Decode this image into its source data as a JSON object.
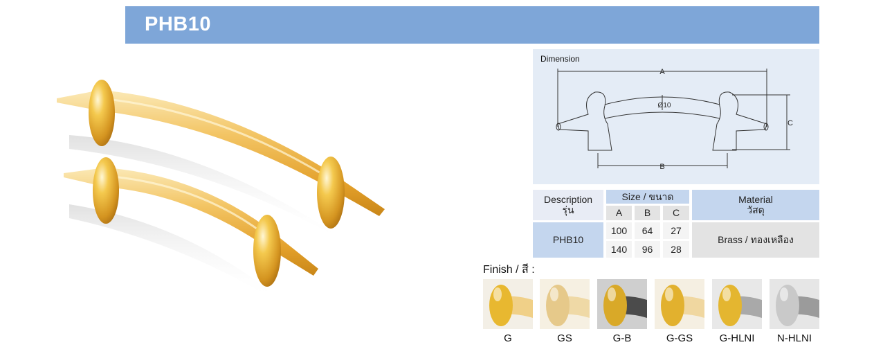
{
  "header": {
    "title": "PHB10"
  },
  "dimension": {
    "title": "Dimension",
    "label_a": "A",
    "label_b": "B",
    "label_c": "C",
    "label_dia": "Ø10"
  },
  "table": {
    "description_header": "Description",
    "description_header_th": "รุ่น",
    "size_header": "Size / ขนาด",
    "col_a": "A",
    "col_b": "B",
    "col_c": "C",
    "material_header": "Material",
    "material_header_th": "วัสดุ",
    "model": "PHB10",
    "rows": [
      {
        "a": "100",
        "b": "64",
        "c": "27"
      },
      {
        "a": "140",
        "b": "96",
        "c": "28"
      }
    ],
    "material": "Brass / ทองเหลือง"
  },
  "finish": {
    "label": "Finish / สี :",
    "options": [
      {
        "code": "G",
        "knob": "#e8b830",
        "bar": "#f0d088",
        "bg": "#f3efe6"
      },
      {
        "code": "GS",
        "knob": "#e6c98a",
        "bar": "#efd9a6",
        "bg": "#f6f0e2"
      },
      {
        "code": "G-B",
        "knob": "#d9a928",
        "bar": "#4b4b4b",
        "bg": "#cfcfcf"
      },
      {
        "code": "G-GS",
        "knob": "#e2b12e",
        "bar": "#f0d7a0",
        "bg": "#f5efe2"
      },
      {
        "code": "G-HLNI",
        "knob": "#e4b630",
        "bar": "#a9a9a9",
        "bg": "#e8e8e8"
      },
      {
        "code": "N-HLNI",
        "knob": "#c9c9c9",
        "bar": "#9b9b9b",
        "bg": "#e6e6e6"
      }
    ]
  },
  "colors": {
    "title_bar": "#7ea6d8",
    "gold": "#e8b02a",
    "gold_light": "#f6e2a4"
  }
}
